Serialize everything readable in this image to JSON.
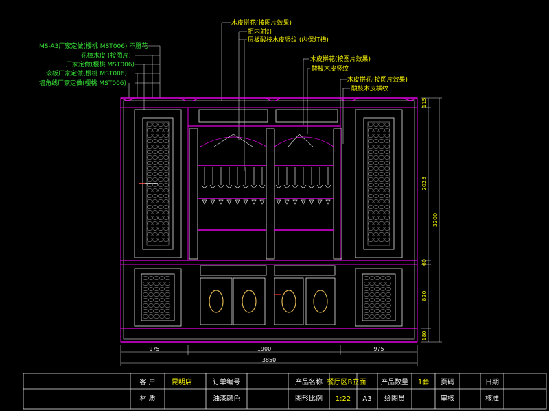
{
  "annotations": {
    "left": [
      "MS-A3厂家定做(樱桃 MST006) 不雕花",
      "花樟木皮 (按图片)",
      "厂家定做(樱桃 MST006)",
      "滚板厂家定做(樱桃 MST006)",
      "墙角线厂家定做(樱桃 MST006)"
    ],
    "top_center": [
      "木皮拼花(按图片效果)",
      "拒内射灯",
      "层板酸枝木皮竖纹 (内保灯槽)"
    ],
    "right_1": [
      "木皮拼花(按图片效果)",
      "酸枝木皮竖纹"
    ],
    "right_2": [
      "木皮拼花(按图片效果)",
      "酸枝木皮横纹"
    ]
  },
  "dimensions": {
    "bottom": [
      "975",
      "1900",
      "975"
    ],
    "total": "3850",
    "right": [
      "115",
      "2025",
      "60",
      "820",
      "180"
    ],
    "overall_height": "3200"
  },
  "title_block": {
    "row1": {
      "client_label": "客 户",
      "client_value": "昆明店",
      "order_label": "订单编号",
      "order_value": "",
      "product_label": "产品名称",
      "product_value": "餐厅区B立面",
      "qty_label": "产品数量",
      "qty_value": "1套",
      "page_label": "页码",
      "date_label": "日期"
    },
    "row2": {
      "material_label": "材 质",
      "paint_label": "油漆颜色",
      "scale_label": "图形比例",
      "scale_value": "1:22",
      "paper_value": "A3",
      "drawer_label": "绘图员",
      "review_label": "审核",
      "approve_label": "核准"
    }
  },
  "colors": {
    "background": "#000000",
    "outline": "#e8e8e8",
    "magenta": "#e000e0",
    "yellow_text": "#f4f000",
    "green_text": "#38e038",
    "dimension": "#f0f0f0"
  }
}
